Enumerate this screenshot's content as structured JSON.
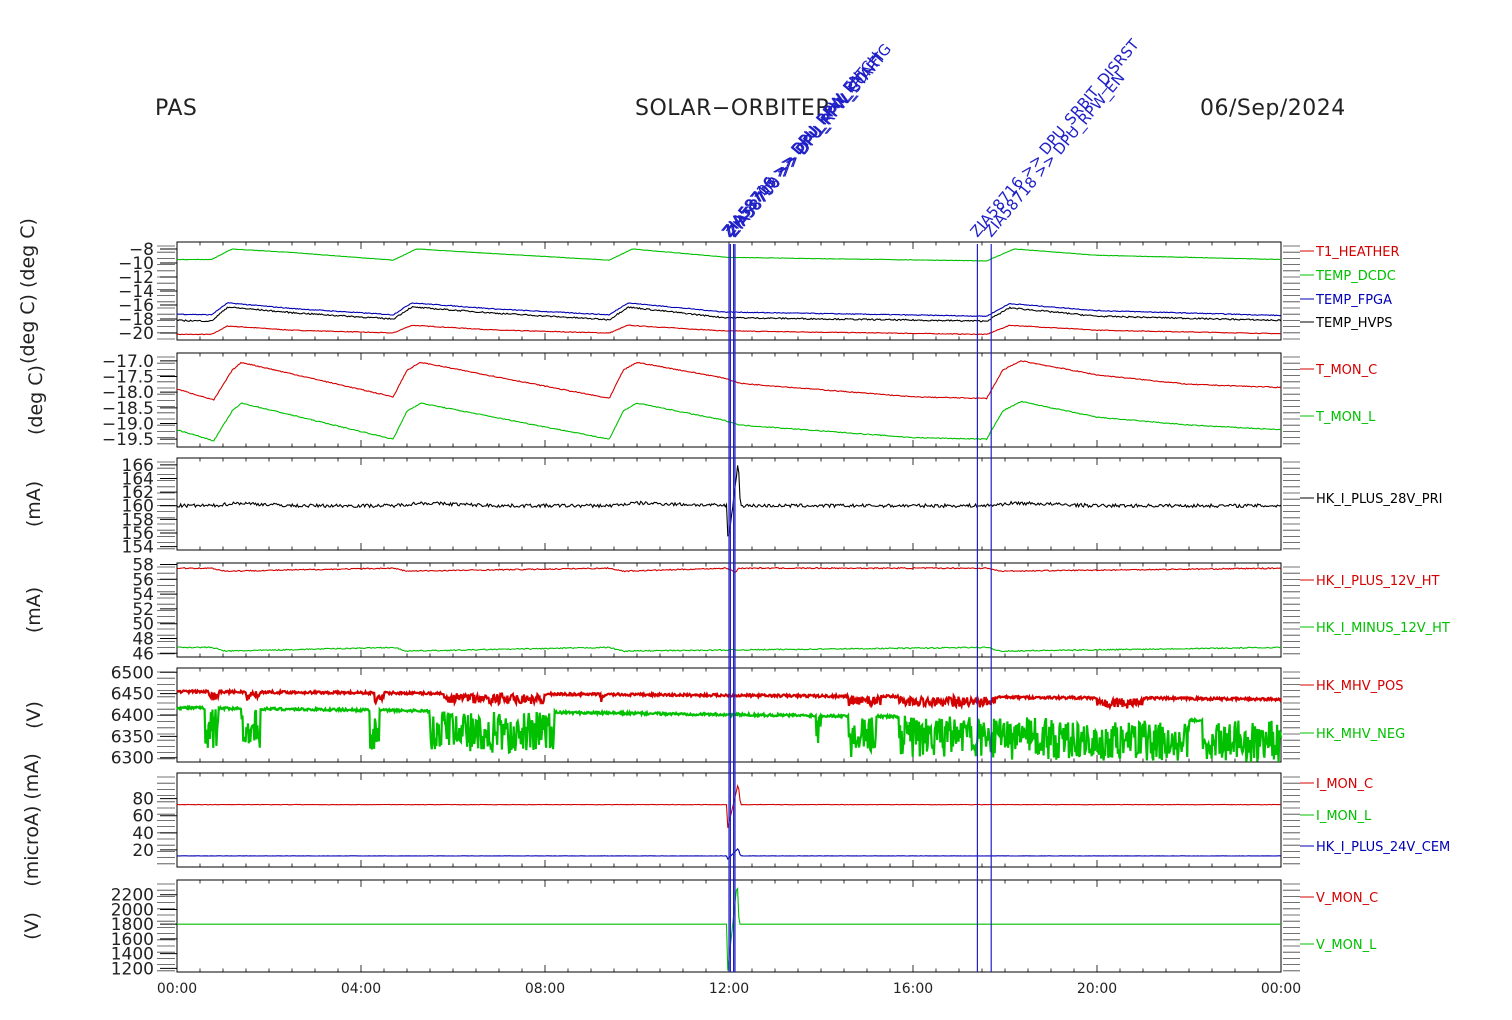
{
  "header": {
    "instrument": "PAS",
    "mission": "SOLAR−ORBITER",
    "date": "06/Sep/2024"
  },
  "colors": {
    "red": "#d40000",
    "green": "#00c000",
    "blue": "#0000b4",
    "black": "#000000",
    "event": "#2020c8"
  },
  "chart_data": {
    "type": "line",
    "x_unit": "hours",
    "xlim": [
      0,
      24
    ],
    "x_ticks": [
      0,
      4,
      8,
      12,
      16,
      20,
      24
    ],
    "x_tick_labels": [
      "00:00",
      "04:00",
      "08:00",
      "12:00",
      "16:00",
      "20:00",
      "00:00"
    ],
    "events": [
      {
        "x": 12.0,
        "label": "ZIA58716 >> DPU_RPW_EN"
      },
      {
        "x": 12.03,
        "label": "ZIA58708 >> DPU_RPW_PATCH"
      },
      {
        "x": 12.1,
        "label": "ZIA58718 >> DPU_RPW_CONFIG"
      },
      {
        "x": 12.13,
        "label": "ZIA58700 >> DPU_RPW_START"
      },
      {
        "x": 17.4,
        "label": "ZIA58716 >> DPU_SRBIT_DISRST"
      },
      {
        "x": 17.7,
        "label": "ZIA58718 >> DPU_RPW_EN"
      }
    ],
    "panels": [
      {
        "ylabel": "(deg C) (deg C)",
        "ylim": [
          -21,
          -7
        ],
        "ticks": [
          -20,
          -18,
          -16,
          -14,
          -12,
          -10,
          -8
        ],
        "tick_labels": [
          "−20",
          "−18",
          "−16",
          "−14",
          "−12",
          "−10",
          "−8"
        ],
        "series": [
          {
            "name": "T1_HEATHER",
            "color": "red",
            "noise": 0.05,
            "x": [
              0,
              0.75,
              1.1,
              2.5,
              4.7,
              5.1,
              7,
              9.4,
              9.8,
              11.9,
              17.6,
              18.1,
              20,
              24
            ],
            "y": [
              -20.2,
              -20.2,
              -19,
              -19.6,
              -20,
              -18.9,
              -19.6,
              -20,
              -18.9,
              -19.7,
              -20.2,
              -18.9,
              -19.6,
              -20.1
            ]
          },
          {
            "name": "TEMP_DCDC",
            "color": "green",
            "noise": 0.03,
            "x": [
              0,
              0.75,
              1.2,
              2.5,
              4.7,
              5.2,
              7,
              9.4,
              9.9,
              12,
              17.6,
              18.2,
              20,
              24
            ],
            "y": [
              -9.5,
              -9.5,
              -8,
              -8.5,
              -9.6,
              -8,
              -8.7,
              -9.6,
              -8,
              -9.2,
              -9.7,
              -8,
              -8.9,
              -9.5
            ]
          },
          {
            "name": "TEMP_FPGA",
            "color": "blue",
            "noise": 0.06,
            "x": [
              0,
              0.75,
              1.1,
              2.5,
              4.7,
              5.1,
              7,
              9.4,
              9.8,
              11.9,
              17.6,
              18.1,
              20,
              24
            ],
            "y": [
              -17.3,
              -17.4,
              -15.7,
              -16.5,
              -17.4,
              -15.7,
              -16.6,
              -17.4,
              -15.7,
              -17,
              -17.6,
              -15.8,
              -16.8,
              -17.5
            ]
          },
          {
            "name": "TEMP_HVPS",
            "color": "black",
            "noise": 0.1,
            "x": [
              0,
              0.75,
              1.1,
              2.5,
              4.7,
              5.1,
              7,
              9.4,
              9.8,
              11.9,
              17.6,
              18.1,
              20,
              24
            ],
            "y": [
              -18.2,
              -18.3,
              -16.3,
              -17.1,
              -18,
              -16.3,
              -17.2,
              -18.1,
              -16.3,
              -17.8,
              -18.3,
              -16.4,
              -17.6,
              -18.2
            ]
          }
        ]
      },
      {
        "ylabel": "(deg C)",
        "ylim": [
          -19.75,
          -16.75
        ],
        "ticks": [
          -19.5,
          -19.0,
          -18.5,
          -18.0,
          -17.5,
          -17.0
        ],
        "tick_labels": [
          "−19.5",
          "−19.0",
          "−18.5",
          "−18.0",
          "−17.5",
          "−17.0"
        ],
        "series": [
          {
            "name": "T_MON_C",
            "color": "red",
            "noise": 0.015,
            "x": [
              0,
              0.8,
              1.2,
              1.4,
              4.7,
              5.0,
              5.3,
              9.4,
              9.7,
              10.0,
              11.9,
              12.25,
              16,
              17.6,
              17.95,
              18.35,
              20,
              22,
              24
            ],
            "y": [
              -17.9,
              -18.25,
              -17.3,
              -17.05,
              -18.15,
              -17.3,
              -17.05,
              -18.2,
              -17.3,
              -17.05,
              -17.55,
              -17.72,
              -18.15,
              -18.2,
              -17.3,
              -17,
              -17.45,
              -17.75,
              -17.85
            ]
          },
          {
            "name": "T_MON_L",
            "color": "green",
            "noise": 0.015,
            "x": [
              0,
              0.8,
              1.2,
              1.4,
              4.7,
              5.0,
              5.3,
              9.4,
              9.7,
              10.0,
              11.9,
              12.25,
              16,
              17.6,
              17.95,
              18.35,
              20,
              22,
              24
            ],
            "y": [
              -19.2,
              -19.55,
              -18.6,
              -18.35,
              -19.5,
              -18.6,
              -18.35,
              -19.5,
              -18.6,
              -18.35,
              -18.9,
              -19.05,
              -19.45,
              -19.5,
              -18.6,
              -18.3,
              -18.8,
              -19.05,
              -19.2
            ]
          }
        ]
      },
      {
        "ylabel": "(mA)",
        "ylim": [
          153.5,
          167
        ],
        "ticks": [
          154,
          156,
          158,
          160,
          162,
          164,
          166
        ],
        "tick_labels": [
          "154",
          "156",
          "158",
          "160",
          "162",
          "164",
          "166"
        ],
        "series": [
          {
            "name": "HK_I_PLUS_28V_PRI",
            "color": "black",
            "noise": 0.25,
            "x": [
              0,
              0.8,
              1.3,
              2.5,
              4.7,
              5.3,
              7,
              9.4,
              10,
              11.95,
              11.98,
              12.2,
              12.25,
              17.6,
              18.2,
              20,
              24
            ],
            "y": [
              160,
              160,
              160.4,
              160,
              160,
              160.4,
              160,
              160,
              160.4,
              160,
              154.5,
              166.5,
              160,
              160,
              160.4,
              160,
              160
            ]
          }
        ]
      },
      {
        "ylabel": "(mA)",
        "ylim": [
          45.5,
          58.2
        ],
        "ticks": [
          46,
          48,
          50,
          52,
          54,
          56,
          58
        ],
        "tick_labels": [
          "46",
          "48",
          "50",
          "52",
          "54",
          "56",
          "58"
        ],
        "series": [
          {
            "name": "HK_I_PLUS_12V_HT",
            "color": "red",
            "noise": 0.08,
            "x": [
              0,
              0.75,
              1.05,
              4.7,
              5.0,
              9.4,
              9.7,
              11.95,
              12.15,
              12.2,
              17.6,
              17.9,
              24
            ],
            "y": [
              57.5,
              57.5,
              57.1,
              57.5,
              57.1,
              57.5,
              57.1,
              57.5,
              56.9,
              57.5,
              57.5,
              57.1,
              57.5
            ]
          },
          {
            "name": "HK_I_MINUS_12V_HT",
            "color": "green",
            "noise": 0.08,
            "x": [
              0,
              0.75,
              1.05,
              4.7,
              5.0,
              9.4,
              9.7,
              17.6,
              17.9,
              24
            ],
            "y": [
              46.8,
              46.8,
              46.3,
              46.8,
              46.3,
              46.8,
              46.3,
              46.8,
              46.3,
              46.8
            ]
          }
        ]
      },
      {
        "ylabel": "(V)",
        "ylim": [
          6290,
          6510
        ],
        "ticks": [
          6300,
          6350,
          6400,
          6450,
          6500
        ],
        "tick_labels": [
          "6300",
          "6350",
          "6400",
          "6450",
          "6500"
        ],
        "series": [
          {
            "name": "HK_MHV_POS",
            "color": "red",
            "style": "hvpos",
            "x": [
              0,
              24
            ],
            "y": [
              6455,
              6437
            ]
          },
          {
            "name": "HK_MHV_NEG",
            "color": "green",
            "style": "hvneg",
            "x": [
              0,
              24
            ],
            "y": [
              6417,
              6385
            ]
          }
        ]
      },
      {
        "ylabel": "(microA) (mA)",
        "ylim": [
          0,
          110
        ],
        "ticks": [
          20,
          40,
          60,
          80
        ],
        "tick_labels": [
          "20",
          "40",
          "60",
          "80"
        ],
        "series": [
          {
            "name": "I_MON_C",
            "color": "red",
            "noise": 0.25,
            "x": [
              0,
              11.95,
              11.97,
              12.2,
              12.25,
              24
            ],
            "y": [
              73,
              73,
              45,
              98,
              73,
              73
            ]
          },
          {
            "name": "I_MON_L",
            "color": "green",
            "noise": 0,
            "x": [],
            "y": []
          },
          {
            "name": "HK_I_PLUS_24V_CEM",
            "color": "blue",
            "noise": 0.15,
            "x": [
              0,
              11.95,
              11.97,
              12.2,
              12.25,
              24
            ],
            "y": [
              13,
              13,
              9,
              22,
              13,
              13
            ]
          }
        ]
      },
      {
        "ylabel": "(V)",
        "ylim": [
          1150,
          2400
        ],
        "ticks": [
          1200,
          1400,
          1600,
          1800,
          2000,
          2200
        ],
        "tick_labels": [
          "1200",
          "1400",
          "1600",
          "1800",
          "2000",
          "2200"
        ],
        "series": [
          {
            "name": "V_MON_C",
            "color": "red",
            "noise": 0,
            "x": [],
            "y": []
          },
          {
            "name": "V_MON_L",
            "color": "green",
            "noise": 0,
            "x": [
              0,
              11.95,
              11.97,
              12.18,
              12.22,
              24
            ],
            "y": [
              1800,
              1800,
              1150,
              2380,
              1800,
              1800
            ]
          }
        ]
      }
    ]
  }
}
